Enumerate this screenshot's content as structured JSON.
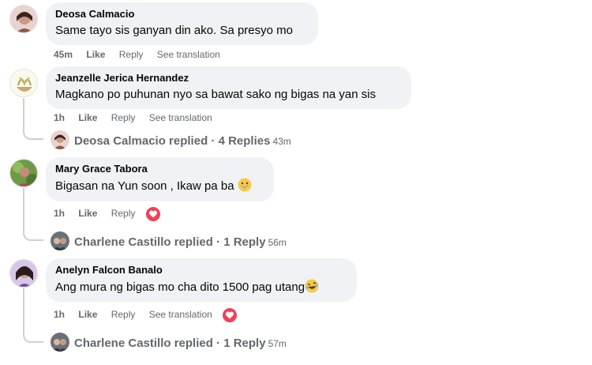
{
  "comments": [
    {
      "author": "Deosa Calmacio",
      "text": "Same tayo sis ganyan din ako. Sa presyo mo",
      "time": "45m",
      "like": "Like",
      "reply": "Reply",
      "see_translation": "See translation"
    },
    {
      "author": "Jeanzelle Jerica Hernandez",
      "text": "Magkano po puhunan nyo sa bawat sako ng bigas na yan sis",
      "time": "1h",
      "like": "Like",
      "reply": "Reply",
      "see_translation": "See translation",
      "replies": {
        "text": "Deosa Calmacio replied · 4 Replies",
        "time": "43m"
      }
    },
    {
      "author": "Mary Grace Tabora",
      "text": "Bigasan na Yun soon , Ikaw pa ba",
      "time": "1h",
      "like": "Like",
      "reply": "Reply",
      "replies": {
        "text": "Charlene Castillo replied · 1 Reply",
        "time": "56m"
      }
    },
    {
      "author": "Anelyn Falcon Banalo",
      "text": "Ang mura ng bigas mo cha dito 1500 pag utang",
      "time": "1h",
      "like": "Like",
      "reply": "Reply",
      "see_translation": "See translation",
      "replies": {
        "text": "Charlene Castillo replied · 1 Reply",
        "time": "57m"
      }
    }
  ],
  "colors": {
    "bubble": "#f0f2f5",
    "meta": "#65676b",
    "heart": "#f33e58"
  }
}
